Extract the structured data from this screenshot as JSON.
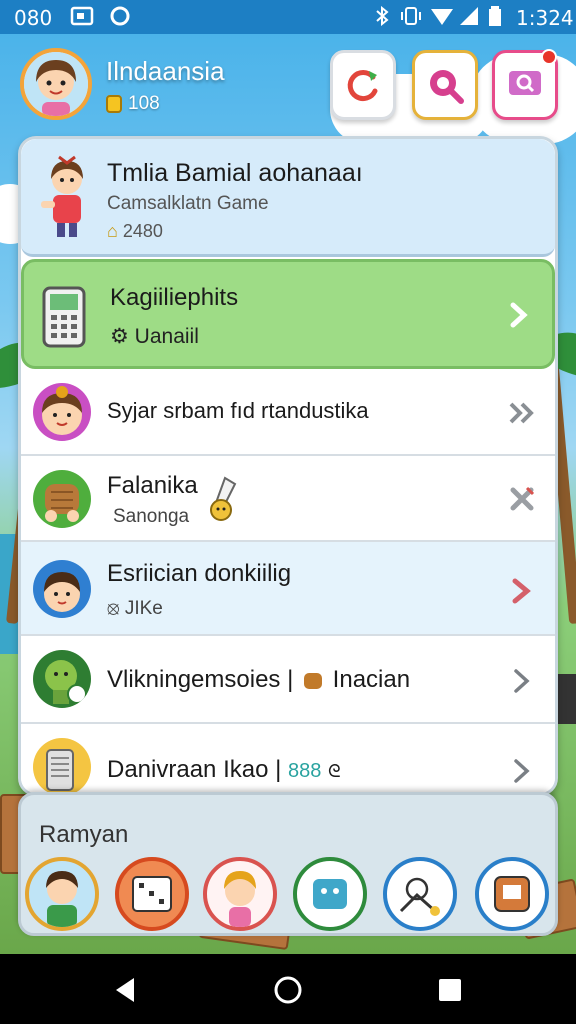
{
  "status_bar": {
    "left_text": "080",
    "time": "1:324"
  },
  "header": {
    "user_name": "Ilndaansia",
    "coins": "108"
  },
  "featured": {
    "title": "Tmlia Bamial aohanaaı",
    "subtitle": "Camsalklatn Game",
    "score": "2480"
  },
  "list": [
    {
      "title": "Kagiiliephits",
      "subtitle": "Uanaiil",
      "style": "green"
    },
    {
      "title": "Syjar srbam fıd rtandustika",
      "subtitle": ""
    },
    {
      "title": "Falanika",
      "subtitle": "Sanonga"
    },
    {
      "title": "Esriician donkiilig",
      "subtitle": "JIKe",
      "style": "blue"
    },
    {
      "title": "Vlikningemsoies |",
      "extra": "Inacian"
    },
    {
      "title": "Danivraan Ikao |",
      "extra": "888"
    }
  ],
  "drawer": {
    "title": "Ramyan"
  },
  "colors": {
    "accent_green": "#9edc86",
    "status_bar": "#1d7fc4",
    "notification": "#e8342a"
  }
}
